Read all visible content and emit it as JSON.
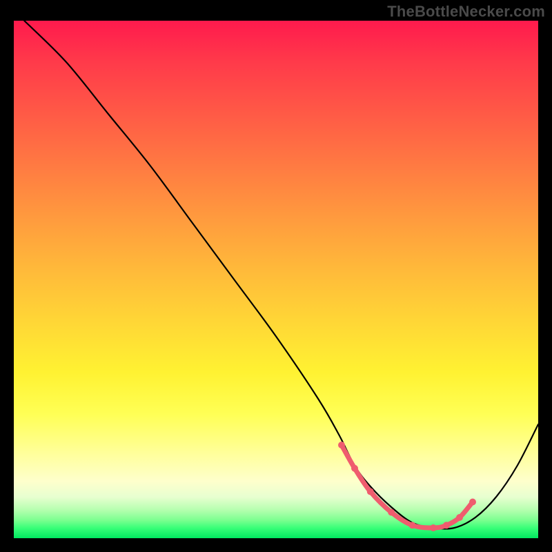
{
  "watermark": "TheBottleNecker.com",
  "chart_data": {
    "type": "line",
    "title": "",
    "xlabel": "",
    "ylabel": "",
    "xlim": [
      0,
      100
    ],
    "ylim": [
      0,
      100
    ],
    "series": [
      {
        "name": "curve",
        "x": [
          2,
          10,
          18,
          26,
          34,
          42,
          50,
          58,
          62,
          65,
          68,
          72,
          76,
          80,
          84,
          88,
          92,
          96,
          100
        ],
        "y": [
          100,
          92,
          82,
          72,
          61,
          50,
          39,
          27,
          20,
          14,
          10,
          6,
          3,
          2,
          2,
          4,
          8,
          14,
          22
        ]
      }
    ],
    "highlight_segment": {
      "name": "bottleneck-zone",
      "x": [
        62.5,
        65,
        68,
        72,
        76,
        80,
        82.5,
        85,
        87.5
      ],
      "y": [
        18,
        13.5,
        9,
        5,
        2.5,
        2,
        2.5,
        4,
        7
      ]
    },
    "highlight_color": "#ef5c6e"
  }
}
